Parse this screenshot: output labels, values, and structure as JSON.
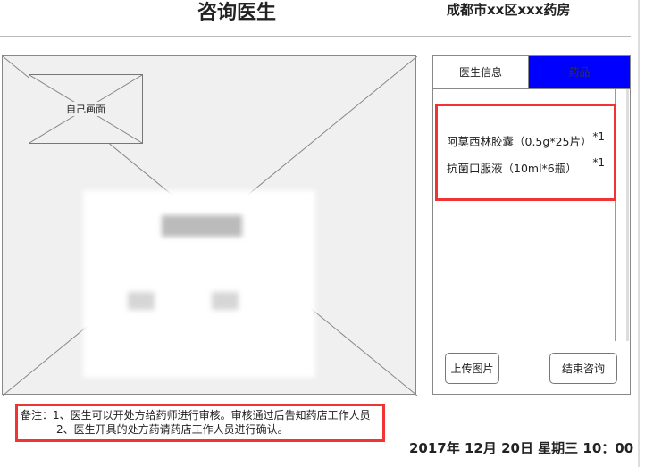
{
  "header": {
    "title": "咨询医生",
    "store": "成都市xx区xxx药房"
  },
  "video": {
    "self_view_label": "自己画面"
  },
  "panel": {
    "tabs": [
      {
        "label": "医生信息",
        "active": false
      },
      {
        "label": "药品",
        "active": true
      }
    ],
    "active_tab_color": "#0000ff",
    "medicines": [
      {
        "name": "阿莫西林胶囊（0.5g*25片）",
        "qty": "*1"
      },
      {
        "name": "抗菌口服液（10ml*6瓶）",
        "qty": "*1"
      }
    ],
    "upload_label": "上传图片",
    "end_label": "结束咨询"
  },
  "notes": {
    "line1": "备注：1、医生可以开处方给药师进行审核。审核通过后告知药店工作人员",
    "line2": "2、医生开具的处方药请药店工作人员进行确认。"
  },
  "datetime": "2017年 12月 20日  星期三  10：00",
  "highlight_color": "#f03333"
}
